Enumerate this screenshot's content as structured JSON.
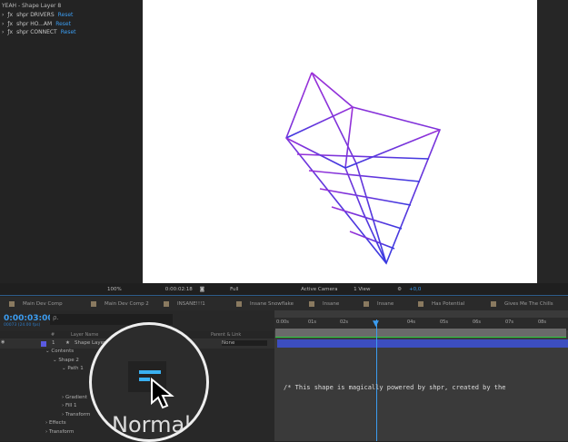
{
  "effects_panel": {
    "title": "YEAH - Shape Layer 8",
    "effects": [
      {
        "name": "shpr DRIVERS",
        "reset": "Reset"
      },
      {
        "name": "shpr HO...AM",
        "reset": "Reset"
      },
      {
        "name": "shpr CONNECT",
        "reset": "Reset"
      }
    ]
  },
  "viewer_toolbar": {
    "zoom": "100%",
    "timecode": "0:00:02:18",
    "resolution": "Full",
    "camera": "Active Camera",
    "views": "1 View",
    "exposure": "+0,0"
  },
  "comp_tabs": [
    "Main Dev Comp",
    "Main Dev Comp 2",
    "INSANE!!!1",
    "Insane Snowflake",
    "Insane",
    "Insane",
    "Has Potential",
    "Gives Me The Chills"
  ],
  "timeline": {
    "current_time": "0:00:03:00",
    "frames": "00073 (24.00 fps)",
    "search_placeholder": "ρ.",
    "columns": {
      "num": "#",
      "layer_name": "Layer Name",
      "parent": "Parent & Link"
    },
    "layers": [
      {
        "num": "1",
        "name": "Shape Layer 8",
        "parent": "None"
      }
    ],
    "tree": [
      "Contents",
      "Shape 2",
      "Path 1",
      "Gradient",
      "Fill 1",
      "Transform",
      "Effects",
      "Transform"
    ],
    "ruler": [
      "0:00s",
      "01s",
      "02s",
      "03s",
      "04s",
      "05s",
      "06s",
      "07s",
      "08s"
    ],
    "expression": "/* This shape is magically powered by shpr, created by the"
  },
  "magnifier": {
    "label": "Normal"
  },
  "colors": {
    "accent": "#3b9cf0",
    "layer_bar": "#3c4ec0",
    "shape_top": "#9b30d8",
    "shape_bottom": "#3a3ae0"
  }
}
